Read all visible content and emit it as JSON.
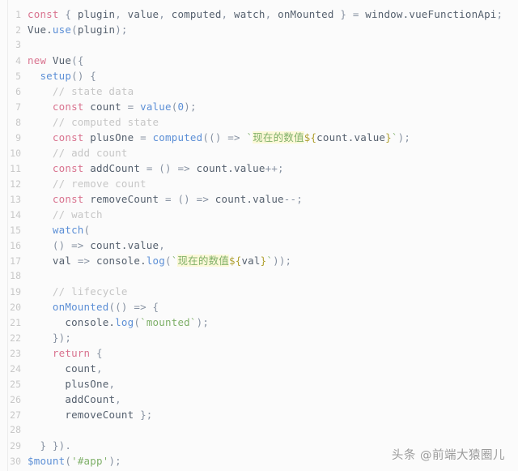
{
  "editor": {
    "language": "javascript",
    "background_color": "#fbfbfb",
    "line_number_color": "#c8c8c8",
    "first_line_number": 1,
    "total_lines": 30
  },
  "colors": {
    "keyword": "#d9738f",
    "function": "#5c8fd6",
    "identifier": "#55606e",
    "string": "#7fb069",
    "comment": "#c6c6c6",
    "number": "#5c8fd6",
    "interpolation": "#b0a030",
    "cjk_highlight_bg": "#fcf8d8"
  },
  "lines": [
    {
      "n": "1",
      "tokens": [
        {
          "t": "const",
          "c": "kw"
        },
        {
          "t": " { ",
          "c": "punc"
        },
        {
          "t": "plugin",
          "c": "plain"
        },
        {
          "t": ", ",
          "c": "punc"
        },
        {
          "t": "value",
          "c": "plain"
        },
        {
          "t": ", ",
          "c": "punc"
        },
        {
          "t": "computed",
          "c": "plain"
        },
        {
          "t": ", ",
          "c": "punc"
        },
        {
          "t": "watch",
          "c": "plain"
        },
        {
          "t": ", ",
          "c": "punc"
        },
        {
          "t": "onMounted",
          "c": "plain"
        },
        {
          "t": " } ",
          "c": "punc"
        },
        {
          "t": "=",
          "c": "punc"
        },
        {
          "t": " window.",
          "c": "plain"
        },
        {
          "t": "vueFunctionApi",
          "c": "plain"
        },
        {
          "t": ";",
          "c": "punc"
        }
      ]
    },
    {
      "n": "2",
      "tokens": [
        {
          "t": "Vue.",
          "c": "plain"
        },
        {
          "t": "use",
          "c": "fn"
        },
        {
          "t": "(",
          "c": "punc"
        },
        {
          "t": "plugin",
          "c": "plain"
        },
        {
          "t": ");",
          "c": "punc"
        }
      ]
    },
    {
      "n": "3",
      "tokens": []
    },
    {
      "n": "4",
      "tokens": [
        {
          "t": "new",
          "c": "kw"
        },
        {
          "t": " ",
          "c": "plain"
        },
        {
          "t": "Vue",
          "c": "plain"
        },
        {
          "t": "({",
          "c": "punc"
        }
      ]
    },
    {
      "n": "5",
      "tokens": [
        {
          "t": "  ",
          "c": "plain"
        },
        {
          "t": "setup",
          "c": "fn"
        },
        {
          "t": "() {",
          "c": "punc"
        }
      ]
    },
    {
      "n": "6",
      "tokens": [
        {
          "t": "    // state data",
          "c": "cmt"
        }
      ]
    },
    {
      "n": "7",
      "tokens": [
        {
          "t": "    ",
          "c": "plain"
        },
        {
          "t": "const",
          "c": "kw"
        },
        {
          "t": " ",
          "c": "plain"
        },
        {
          "t": "count",
          "c": "plain"
        },
        {
          "t": " = ",
          "c": "punc"
        },
        {
          "t": "value",
          "c": "fn"
        },
        {
          "t": "(",
          "c": "punc"
        },
        {
          "t": "0",
          "c": "num"
        },
        {
          "t": ");",
          "c": "punc"
        }
      ]
    },
    {
      "n": "8",
      "tokens": [
        {
          "t": "    // computed state",
          "c": "cmt"
        }
      ]
    },
    {
      "n": "9",
      "tokens": [
        {
          "t": "    ",
          "c": "plain"
        },
        {
          "t": "const",
          "c": "kw"
        },
        {
          "t": " ",
          "c": "plain"
        },
        {
          "t": "plusOne",
          "c": "plain"
        },
        {
          "t": " = ",
          "c": "punc"
        },
        {
          "t": "computed",
          "c": "fn"
        },
        {
          "t": "(() => ",
          "c": "punc"
        },
        {
          "t": "`",
          "c": "str"
        },
        {
          "t": "现在的数值",
          "c": "cn"
        },
        {
          "t": "${",
          "c": "interp"
        },
        {
          "t": "count.value",
          "c": "plain"
        },
        {
          "t": "}",
          "c": "interp"
        },
        {
          "t": "`",
          "c": "str"
        },
        {
          "t": ");",
          "c": "punc"
        }
      ]
    },
    {
      "n": "10",
      "tokens": [
        {
          "t": "    // add count",
          "c": "cmt"
        }
      ]
    },
    {
      "n": "11",
      "tokens": [
        {
          "t": "    ",
          "c": "plain"
        },
        {
          "t": "const",
          "c": "kw"
        },
        {
          "t": " ",
          "c": "plain"
        },
        {
          "t": "addCount",
          "c": "plain"
        },
        {
          "t": " = () => ",
          "c": "punc"
        },
        {
          "t": "count.value",
          "c": "plain"
        },
        {
          "t": "++;",
          "c": "punc"
        }
      ]
    },
    {
      "n": "12",
      "tokens": [
        {
          "t": "    // remove count",
          "c": "cmt"
        }
      ]
    },
    {
      "n": "13",
      "tokens": [
        {
          "t": "    ",
          "c": "plain"
        },
        {
          "t": "const",
          "c": "kw"
        },
        {
          "t": " ",
          "c": "plain"
        },
        {
          "t": "removeCount",
          "c": "plain"
        },
        {
          "t": " = () => ",
          "c": "punc"
        },
        {
          "t": "count.value",
          "c": "plain"
        },
        {
          "t": "--;",
          "c": "punc"
        }
      ]
    },
    {
      "n": "14",
      "tokens": [
        {
          "t": "    // watch",
          "c": "cmt"
        }
      ]
    },
    {
      "n": "15",
      "tokens": [
        {
          "t": "    ",
          "c": "plain"
        },
        {
          "t": "watch",
          "c": "fn"
        },
        {
          "t": "(",
          "c": "punc"
        }
      ]
    },
    {
      "n": "16",
      "tokens": [
        {
          "t": "    () => ",
          "c": "punc"
        },
        {
          "t": "count.value",
          "c": "plain"
        },
        {
          "t": ",",
          "c": "punc"
        }
      ]
    },
    {
      "n": "17",
      "tokens": [
        {
          "t": "    ",
          "c": "plain"
        },
        {
          "t": "val",
          "c": "plain"
        },
        {
          "t": " => ",
          "c": "punc"
        },
        {
          "t": "console.",
          "c": "plain"
        },
        {
          "t": "log",
          "c": "fn"
        },
        {
          "t": "(",
          "c": "punc"
        },
        {
          "t": "`",
          "c": "str"
        },
        {
          "t": "现在的数值",
          "c": "cn"
        },
        {
          "t": "${",
          "c": "interp"
        },
        {
          "t": "val",
          "c": "plain"
        },
        {
          "t": "}",
          "c": "interp"
        },
        {
          "t": "`",
          "c": "str"
        },
        {
          "t": "));",
          "c": "punc"
        }
      ]
    },
    {
      "n": "18",
      "tokens": []
    },
    {
      "n": "19",
      "tokens": [
        {
          "t": "    // lifecycle",
          "c": "cmt"
        }
      ]
    },
    {
      "n": "20",
      "tokens": [
        {
          "t": "    ",
          "c": "plain"
        },
        {
          "t": "onMounted",
          "c": "fn"
        },
        {
          "t": "(() => {",
          "c": "punc"
        }
      ]
    },
    {
      "n": "21",
      "tokens": [
        {
          "t": "      console.",
          "c": "plain"
        },
        {
          "t": "log",
          "c": "fn"
        },
        {
          "t": "(",
          "c": "punc"
        },
        {
          "t": "`mounted`",
          "c": "str"
        },
        {
          "t": ");",
          "c": "punc"
        }
      ]
    },
    {
      "n": "22",
      "tokens": [
        {
          "t": "    });",
          "c": "punc"
        }
      ]
    },
    {
      "n": "23",
      "tokens": [
        {
          "t": "    ",
          "c": "plain"
        },
        {
          "t": "return",
          "c": "kw"
        },
        {
          "t": " {",
          "c": "punc"
        }
      ]
    },
    {
      "n": "24",
      "tokens": [
        {
          "t": "      ",
          "c": "plain"
        },
        {
          "t": "count",
          "c": "plain"
        },
        {
          "t": ",",
          "c": "punc"
        }
      ]
    },
    {
      "n": "25",
      "tokens": [
        {
          "t": "      ",
          "c": "plain"
        },
        {
          "t": "plusOne",
          "c": "plain"
        },
        {
          "t": ",",
          "c": "punc"
        }
      ]
    },
    {
      "n": "26",
      "tokens": [
        {
          "t": "      ",
          "c": "plain"
        },
        {
          "t": "addCount",
          "c": "plain"
        },
        {
          "t": ",",
          "c": "punc"
        }
      ]
    },
    {
      "n": "27",
      "tokens": [
        {
          "t": "      ",
          "c": "plain"
        },
        {
          "t": "removeCount",
          "c": "plain"
        },
        {
          "t": " };",
          "c": "punc"
        }
      ]
    },
    {
      "n": "28",
      "tokens": []
    },
    {
      "n": "29",
      "tokens": [
        {
          "t": "  } }).",
          "c": "punc"
        }
      ]
    },
    {
      "n": "30",
      "tokens": [
        {
          "t": "$mount",
          "c": "fn"
        },
        {
          "t": "(",
          "c": "punc"
        },
        {
          "t": "'#app'",
          "c": "str"
        },
        {
          "t": ");",
          "c": "punc"
        }
      ]
    }
  ],
  "watermark": {
    "text": "头条 @前端大猿圈儿"
  }
}
